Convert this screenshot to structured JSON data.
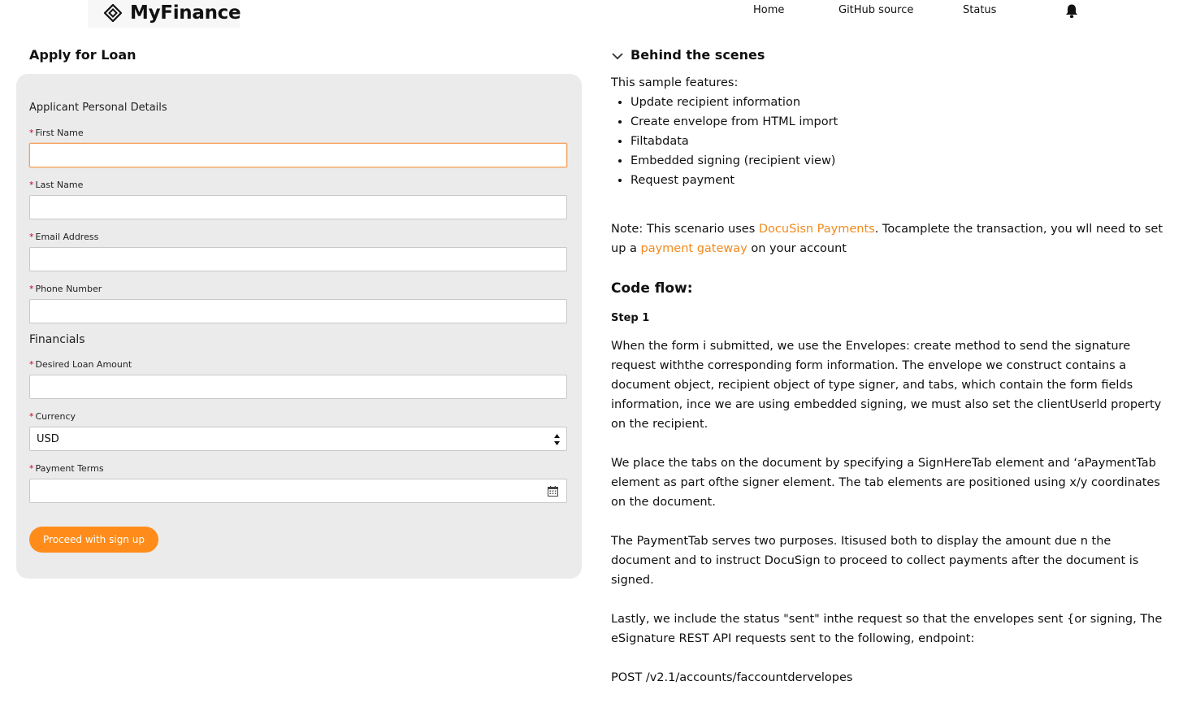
{
  "header": {
    "brand": "MyFinance",
    "nav": [
      {
        "label": "Home"
      },
      {
        "label": "GitHub source"
      },
      {
        "label": "Status"
      }
    ]
  },
  "form": {
    "title": "Apply for Loan",
    "personal_section": "Applicant Personal Details",
    "financials_section": "Financials",
    "required_mark": "*",
    "fields": {
      "first_name": {
        "label": "First Name",
        "value": ""
      },
      "last_name": {
        "label": "Last Name",
        "value": ""
      },
      "email": {
        "label": "Email Address",
        "value": ""
      },
      "phone": {
        "label": "Phone Number",
        "value": ""
      },
      "loan_amount": {
        "label": "Desired Loan Amount",
        "value": ""
      },
      "currency": {
        "label": "Currency",
        "value": "USD"
      },
      "payment_terms": {
        "label": "Payment Terms",
        "value": ""
      }
    },
    "submit_label": "Proceed with sign up"
  },
  "behind": {
    "title": "Behind the scenes",
    "intro": "This sample features:",
    "features": [
      "Update recipient information",
      "Create envelope from HTML import",
      "Filtabdata",
      "Embedded signing (recipient view)",
      "Request payment"
    ],
    "note": {
      "part1": "Note: This scenario uses ",
      "link1": "DocuSisn Payments",
      "part2": ". Tocamplete the transaction, you wll need to set up a ",
      "link2": "payment gateway",
      "part3": " on your account"
    },
    "code_flow_title": "Code flow:",
    "step_label": "Step 1",
    "paragraphs": [
      "When the form i submitted, we use the Envelopes: create method to send the signature request withthe corresponding form information. The envelope we construct contains a document object, recipient object of type signer, and tabs, which contain the form fields information, ince we are using embedded signing, we must also set the clientUserld property on the recipient.",
      "We place the tabs on the document by specifying a SignHereTab element and ‘aPaymentTab element as part ofthe signer element. The tab elements are positioned using x/y coordinates on the document.",
      "The PaymentTab serves two purposes. Itisused both to display the amount due n the document and to instruct DocuSign to proceed to collect payments after the document is signed.",
      "Lastly, we include the status \"sent\" inthe request so that the envelopes sent {or signing, The eSignature REST API requests sent to the following, endpoint:"
    ],
    "endpoint": "POST /v2.1/accounts/faccountdervelopes"
  },
  "colors": {
    "accent": "#ff8c1a",
    "link": "#f28a1c",
    "required": "#d0021b",
    "card_bg": "#ebebeb"
  },
  "icons": [
    "diamond-logo-icon",
    "bell-icon",
    "chevron-down-icon",
    "spinner-arrows-icon",
    "calendar-icon"
  ]
}
